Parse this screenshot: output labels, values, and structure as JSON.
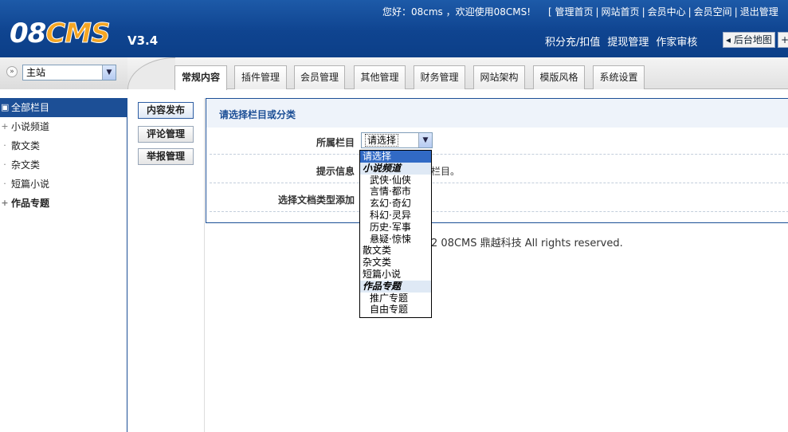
{
  "header": {
    "logo_text": "08CMS",
    "logo_prefix": "08",
    "logo_suffix": "CMS",
    "version": "V3.4",
    "welcome": "您好：08cms ，欢迎使用08CMS!",
    "top_links": [
      "[ 管理首页",
      "网站首页",
      "会员中心",
      "会员空间",
      "退出管理"
    ],
    "quick_links": [
      "积分充/扣值",
      "提现管理",
      "作家审核"
    ],
    "map_button": "◂ 后台地图",
    "map_button_2": "+"
  },
  "site_picker": {
    "chevron": "»",
    "selected": "主站",
    "arrow": "▼"
  },
  "tabs": [
    {
      "label": "常规内容",
      "active": true
    },
    {
      "label": "插件管理",
      "active": false
    },
    {
      "label": "会员管理",
      "active": false
    },
    {
      "label": "其他管理",
      "active": false
    },
    {
      "label": "财务管理",
      "active": false
    },
    {
      "label": "网站架构",
      "active": false
    },
    {
      "label": "模版风格",
      "active": false
    },
    {
      "label": "系统设置",
      "active": false
    }
  ],
  "tree": [
    {
      "label": "全部栏目",
      "toggle": "▣",
      "selected": true,
      "bold": false
    },
    {
      "label": "小说频道",
      "toggle": "+",
      "selected": false,
      "bold": false
    },
    {
      "label": "散文类",
      "toggle": "·",
      "selected": false,
      "bold": false
    },
    {
      "label": "杂文类",
      "toggle": "·",
      "selected": false,
      "bold": false
    },
    {
      "label": "短篇小说",
      "toggle": "·",
      "selected": false,
      "bold": false
    },
    {
      "label": "作品专题",
      "toggle": "+",
      "selected": false,
      "bold": true
    }
  ],
  "submenu": [
    "内容发布",
    "评论管理",
    "举报管理"
  ],
  "panel": {
    "title": "请选择栏目或分类",
    "field_column_label": "所属栏目",
    "field_column_value": "请选择",
    "field_hint_label": "提示信息",
    "field_hint_value": "栏目。",
    "field_doctype_label": "选择文档类型添加"
  },
  "footer": "C 2008-2012 08CMS 鼎越科技 All rights reserved.",
  "dropdown_options": [
    {
      "label": "请选择",
      "kind": "sel"
    },
    {
      "label": "小说频道",
      "kind": "grp"
    },
    {
      "label": "武侠·仙侠",
      "kind": "ind"
    },
    {
      "label": "言情·都市",
      "kind": "ind"
    },
    {
      "label": "玄幻·奇幻",
      "kind": "ind"
    },
    {
      "label": "科幻·灵异",
      "kind": "ind"
    },
    {
      "label": "历史·军事",
      "kind": "ind"
    },
    {
      "label": "悬疑·惊悚",
      "kind": "ind"
    },
    {
      "label": "散文类",
      "kind": "plain"
    },
    {
      "label": "杂文类",
      "kind": "plain"
    },
    {
      "label": "短篇小说",
      "kind": "plain"
    },
    {
      "label": "作品专题",
      "kind": "grp"
    },
    {
      "label": "推广专题",
      "kind": "ind"
    },
    {
      "label": "自由专题",
      "kind": "ind"
    }
  ],
  "colors": {
    "header_blue": "#0f4490",
    "tree_selected": "#1c4f96",
    "dropdown_selected": "#316ac5",
    "logo_orange": "#f5a623"
  }
}
